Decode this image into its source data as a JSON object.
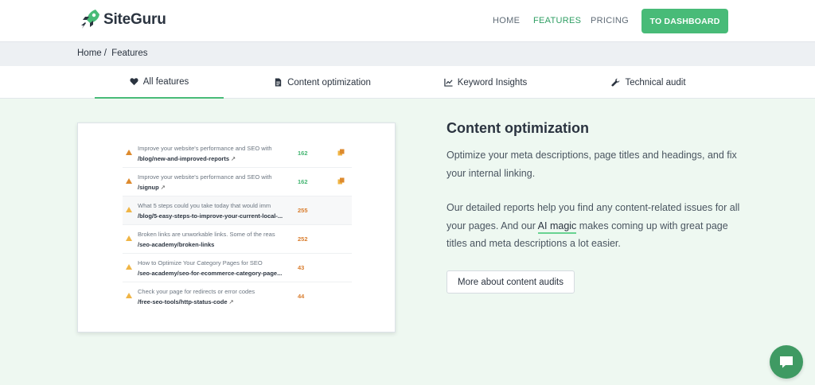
{
  "brand": {
    "name": "SiteGuru"
  },
  "nav": {
    "items": [
      {
        "label": "HOME",
        "active": false
      },
      {
        "label": "FEATURES",
        "active": true
      },
      {
        "label": "PRICING",
        "active": false
      }
    ],
    "dashboard_button": "TO DASHBOARD"
  },
  "breadcrumb": {
    "home": "Home",
    "separator": "/",
    "current": "Features"
  },
  "tabs": [
    {
      "label": "All features",
      "icon": "heart-icon",
      "active": true
    },
    {
      "label": "Content optimization",
      "icon": "document-icon",
      "active": false
    },
    {
      "label": "Keyword Insights",
      "icon": "line-chart-icon",
      "active": false
    },
    {
      "label": "Technical audit",
      "icon": "wrench-icon",
      "active": false
    }
  ],
  "report_rows": [
    {
      "text": "Improve your website's performance and SEO with",
      "url": "/blog/new-and-improved-reports",
      "value": "162",
      "value_color": "green",
      "copy_icon": true
    },
    {
      "text": "Improve your website's performance and SEO with",
      "url": "/signup",
      "value": "162",
      "value_color": "green",
      "copy_icon": true
    },
    {
      "text": "What 5 steps could you take today that would imm",
      "url": "/blog/5-easy-steps-to-improve-your-current-local-...",
      "value": "255",
      "value_color": "orange",
      "copy_icon": false
    },
    {
      "text": "Broken links are unworkable links. Some of the reas",
      "url": "/seo-academy/broken-links",
      "value": "252",
      "value_color": "orange",
      "copy_icon": false
    },
    {
      "text": "How to Optimize Your Category Pages for SEO",
      "url": "/seo-academy/seo-for-ecommerce-category-page...",
      "value": "43",
      "value_color": "orange",
      "copy_icon": false
    },
    {
      "text": "Check your page for redirects or error codes",
      "url": "/free-seo-tools/http-status-code",
      "value": "44",
      "value_color": "orange",
      "copy_icon": false
    }
  ],
  "content": {
    "title": "Content optimization",
    "para1": "Optimize your meta descriptions, page titles and headings, and fix your internal linking.",
    "para2_before": "Our detailed reports help you find any content-related issues for all your pages. And our ",
    "para2_highlight": "AI magic",
    "para2_after": " makes coming up with great page titles and meta descriptions a lot easier.",
    "button": "More about content audits"
  },
  "colors": {
    "accent": "#48bb78",
    "main_bg": "#eef8f1",
    "warning": "#dd8a2e",
    "chat_button": "#3f9a63"
  },
  "chat": {
    "icon": "chat-bubble-icon"
  }
}
